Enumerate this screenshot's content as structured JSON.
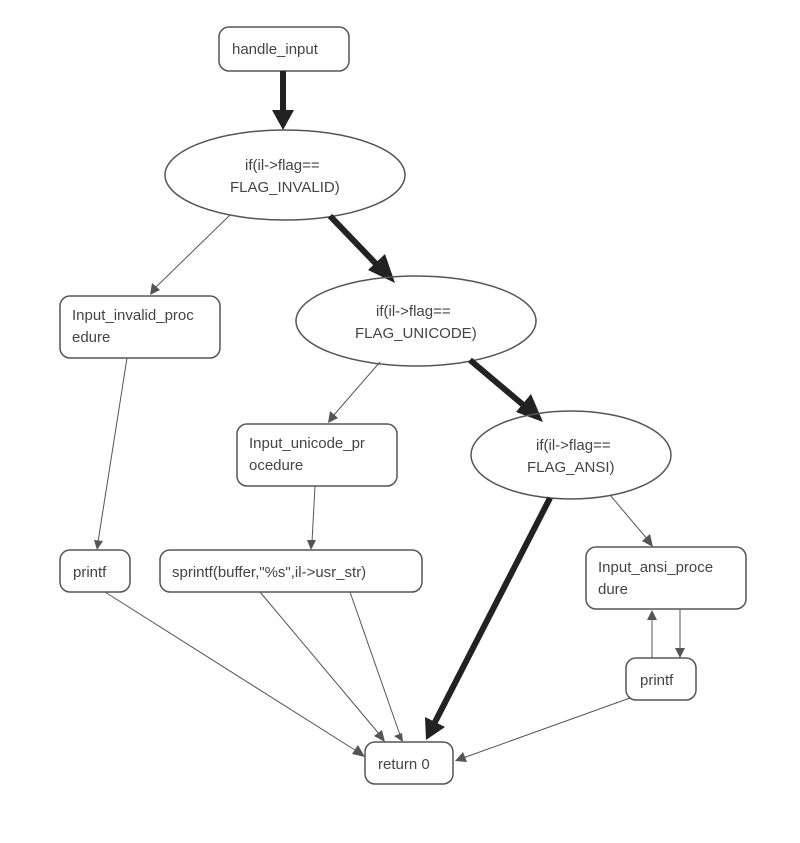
{
  "nodes": {
    "handle_input": "handle_input",
    "if_invalid_l1": "if(il->flag==",
    "if_invalid_l2": "FLAG_INVALID)",
    "input_invalid_l1": "Input_invalid_proc",
    "input_invalid_l2": "edure",
    "if_unicode_l1": "if(il->flag==",
    "if_unicode_l2": "FLAG_UNICODE)",
    "input_unicode_l1": "Input_unicode_pr",
    "input_unicode_l2": "ocedure",
    "if_ansi_l1": "if(il->flag==",
    "if_ansi_l2": "FLAG_ANSI)",
    "input_ansi_l1": "Input_ansi_proce",
    "input_ansi_l2": "dure",
    "printf1": "printf",
    "sprintf": "sprintf(buffer,\"%s\",il->usr_str)",
    "printf2": "printf",
    "return0": "return 0"
  }
}
